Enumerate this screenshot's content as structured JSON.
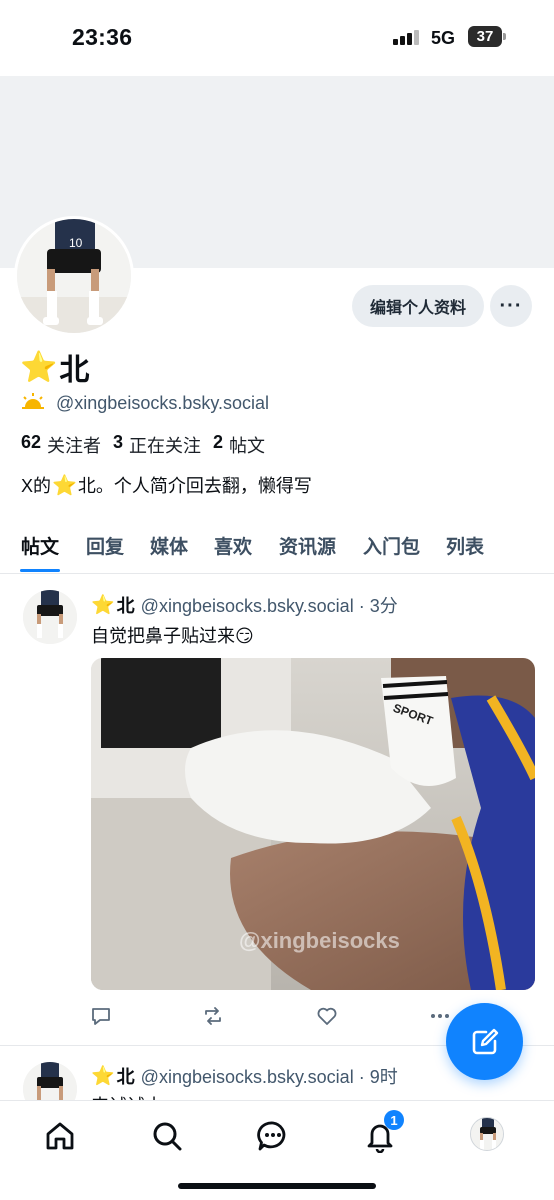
{
  "status_bar": {
    "time": "23:36",
    "network": "5G",
    "battery": "37"
  },
  "profile": {
    "display_name": "北",
    "handle": "@xingbeisocks.bsky.social",
    "edit_button": "编辑个人资料",
    "more_button": "···",
    "stats": {
      "followers_count": "62",
      "followers_label": "关注者",
      "following_count": "3",
      "following_label": "正在关注",
      "posts_count": "2",
      "posts_label": "帖文"
    },
    "bio_prefix": "X的",
    "bio_suffix": "北。个人简介回去翻，懒得写"
  },
  "tabs": [
    "帖文",
    "回复",
    "媒体",
    "喜欢",
    "资讯源",
    "入门包",
    "列表"
  ],
  "posts": [
    {
      "name": "北",
      "handle": "@xingbeisocks.bsky.social · 3分",
      "text": "自觉把鼻子贴过来😏",
      "watermark": "@xingbeisocks",
      "sock_brand": "SPORT"
    },
    {
      "name": "北",
      "handle": "@xingbeisocks.bsky.social · 9时",
      "text": "来试试水"
    }
  ],
  "nav": {
    "notifications_badge": "1"
  },
  "colors": {
    "accent": "#1083fe",
    "star": "#f7b500",
    "banner": "#eff1f3"
  },
  "icons": [
    "home-icon",
    "search-icon",
    "chat-icon",
    "bell-icon",
    "compose-icon",
    "reply-icon",
    "repost-icon",
    "like-icon",
    "more-icon"
  ]
}
